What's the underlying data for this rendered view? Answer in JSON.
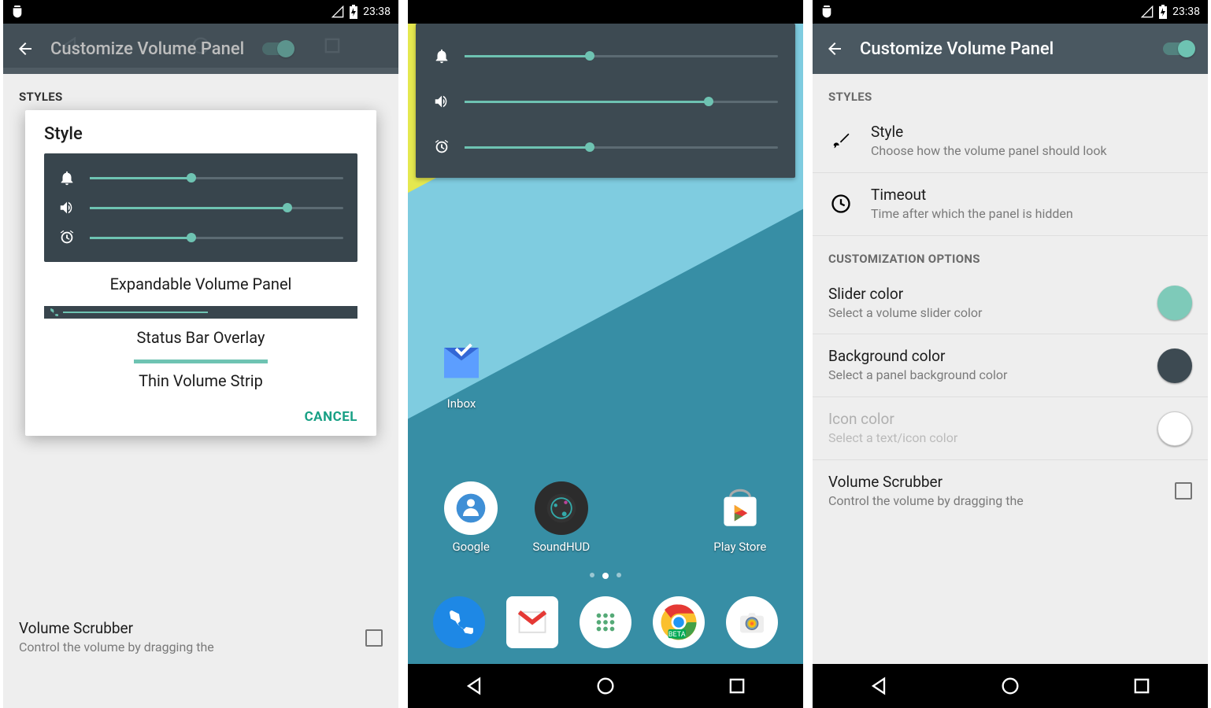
{
  "status": {
    "time": "23:38"
  },
  "appbar": {
    "title": "Customize Volume Panel"
  },
  "dialog": {
    "title": "Style",
    "option1": "Expandable Volume Panel",
    "option2": "Status Bar Overlay",
    "option3": "Thin Volume Strip",
    "cancel": "CANCEL",
    "sliders": {
      "notif": 40,
      "media": 78,
      "alarm": 40
    }
  },
  "overlay": {
    "notif": 40,
    "media": 78,
    "alarm": 40
  },
  "home": {
    "apps": [
      {
        "label": "Inbox"
      },
      {
        "label": "Google"
      },
      {
        "label": "SoundHUD"
      },
      {
        "label": "Play Store"
      }
    ]
  },
  "settings": {
    "section_styles": "STYLES",
    "style_title": "Style",
    "style_sum": "Choose how the volume panel should look",
    "timeout_title": "Timeout",
    "timeout_sum": "Time after which the panel is hidden",
    "section_custom": "CUSTOMIZATION OPTIONS",
    "slider_color_title": "Slider color",
    "slider_color_sum": "Select a volume slider color",
    "slider_color_value": "#7ecab9",
    "bg_color_title": "Background color",
    "bg_color_sum": "Select a panel background color",
    "bg_color_value": "#3d4a52",
    "icon_color_title": "Icon color",
    "icon_color_sum": "Select a text/icon color",
    "icon_color_value": "#ffffff",
    "scrubber_title": "Volume Scrubber",
    "scrubber_sum": "Control the volume by dragging the"
  }
}
